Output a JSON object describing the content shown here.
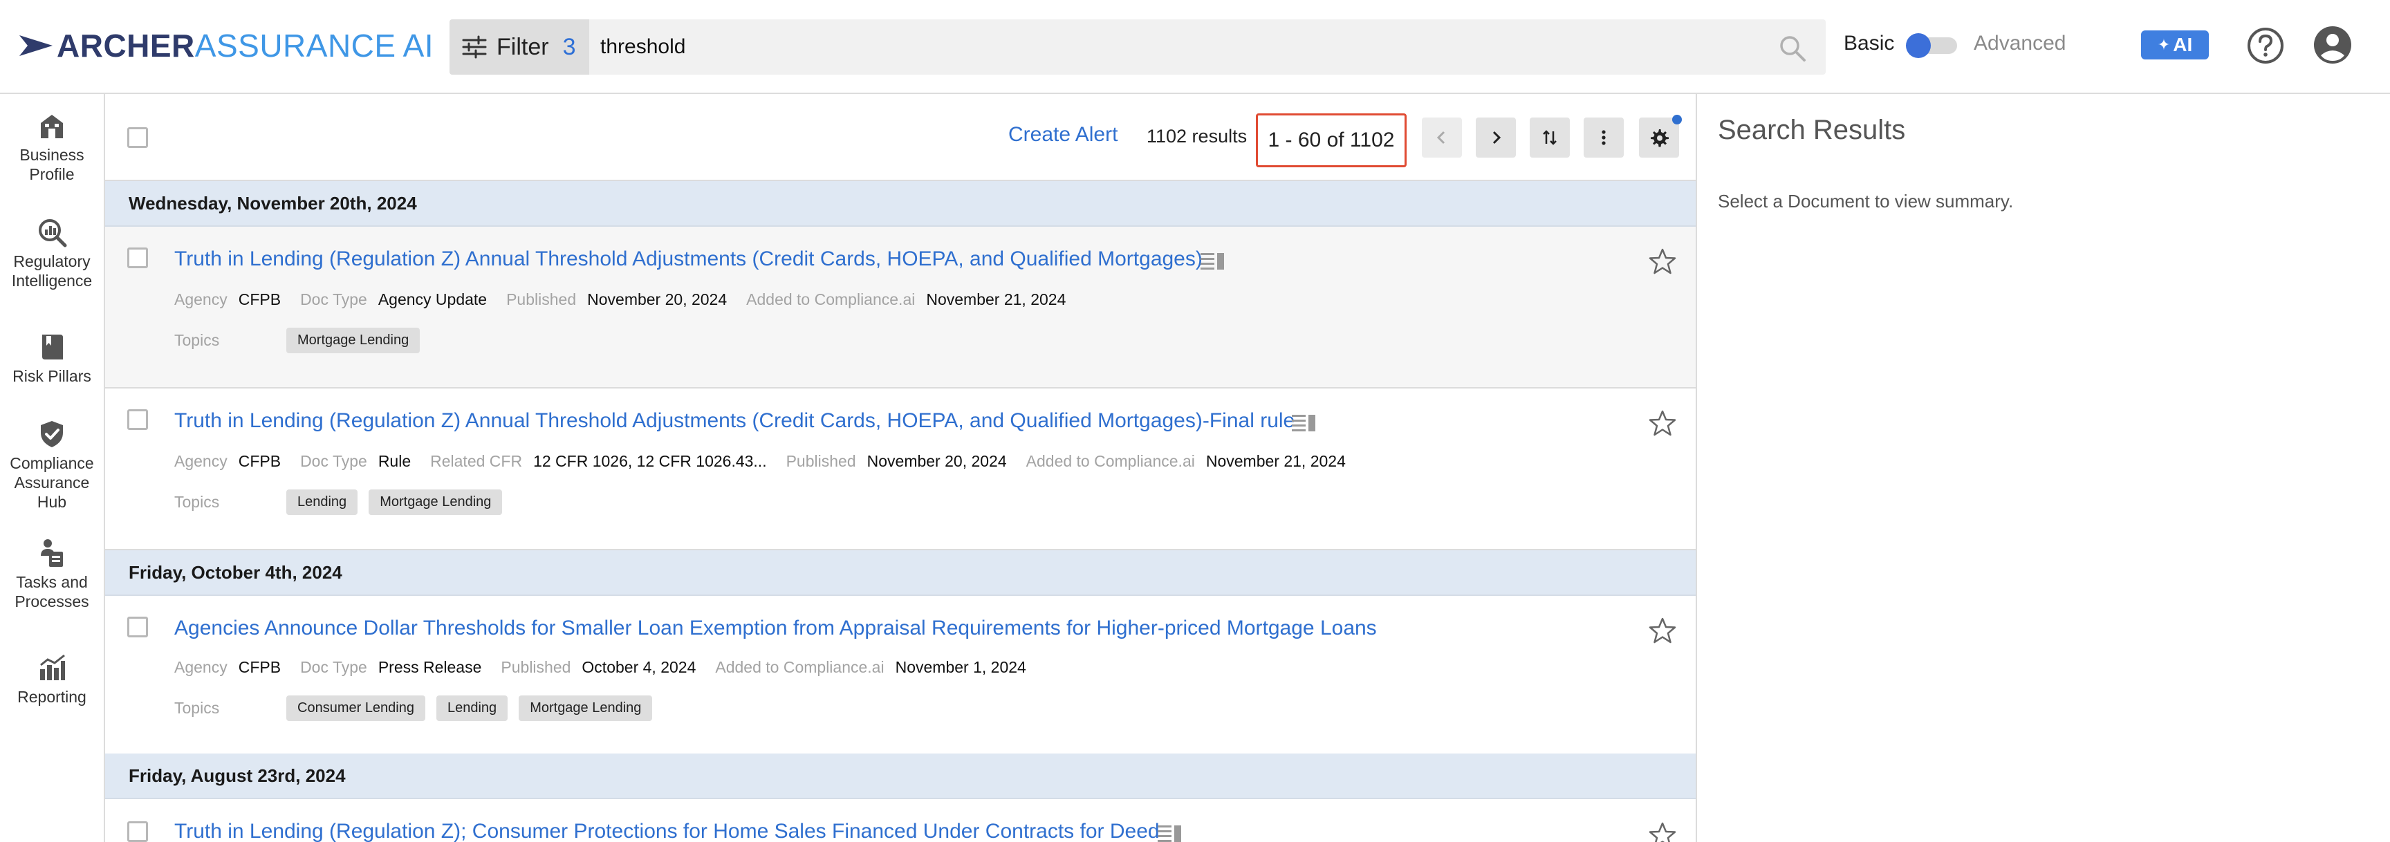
{
  "brand": {
    "archer": "ARCHER",
    "assurance": "ASSURANCE",
    "ai": "AI"
  },
  "search": {
    "filter_label": "Filter",
    "filter_count": "3",
    "query": "threshold"
  },
  "mode": {
    "basic": "Basic",
    "advanced": "Advanced",
    "basic_selected": true
  },
  "header": {
    "ai_button": "AI"
  },
  "sidebar": {
    "items": [
      {
        "label": "Business Profile",
        "icon": "building-icon"
      },
      {
        "label": "Regulatory Intelligence",
        "icon": "magnify-chart-icon"
      },
      {
        "label": "Risk Pillars",
        "icon": "book-icon"
      },
      {
        "label": "Compliance Assurance Hub",
        "icon": "shield-check-icon"
      },
      {
        "label": "Tasks and Processes",
        "icon": "clipboard-person-icon"
      },
      {
        "label": "Reporting",
        "icon": "bar-chart-icon"
      }
    ]
  },
  "toolbar": {
    "create_alert": "Create Alert",
    "results_count": "1102 results",
    "range": "1 - 60 of 1102"
  },
  "groups": [
    {
      "date": "Wednesday, November 20th, 2024"
    },
    {
      "date": "Friday, October 4th, 2024"
    },
    {
      "date": "Friday, August 23rd, 2024"
    }
  ],
  "meta_labels": {
    "agency": "Agency",
    "doc_type": "Doc Type",
    "related_cfr": "Related CFR",
    "published": "Published",
    "added": "Added to Compliance.ai",
    "topics": "Topics"
  },
  "results": [
    {
      "title": "Truth in Lending (Regulation Z) Annual Threshold Adjustments (Credit Cards, HOEPA, and Qualified Mortgages)",
      "agency": "CFPB",
      "doc_type": "Agency Update",
      "published": "November 20, 2024",
      "added": "November 21, 2024",
      "topics": [
        "Mortgage Lending"
      ]
    },
    {
      "title": "Truth in Lending (Regulation Z) Annual Threshold Adjustments (Credit Cards, HOEPA, and Qualified Mortgages)-Final rule",
      "agency": "CFPB",
      "doc_type": "Rule",
      "related_cfr": "12 CFR 1026, 12 CFR 1026.43...",
      "published": "November 20, 2024",
      "added": "November 21, 2024",
      "topics": [
        "Lending",
        "Mortgage Lending"
      ]
    },
    {
      "title": "Agencies Announce Dollar Thresholds for Smaller Loan Exemption from Appraisal Requirements for Higher-priced Mortgage Loans",
      "agency": "CFPB",
      "doc_type": "Press Release",
      "published": "October 4, 2024",
      "added": "November 1, 2024",
      "topics": [
        "Consumer Lending",
        "Lending",
        "Mortgage Lending"
      ]
    },
    {
      "title": "Truth in Lending (Regulation Z); Consumer Protections for Home Sales Financed Under Contracts for Deed"
    }
  ],
  "panel": {
    "title": "Search Results",
    "subtitle": "Select a Document to view summary."
  },
  "colors": {
    "accent": "#2f6fcf",
    "highlight_border": "#e04b33",
    "date_header_bg": "#dfe8f3"
  }
}
